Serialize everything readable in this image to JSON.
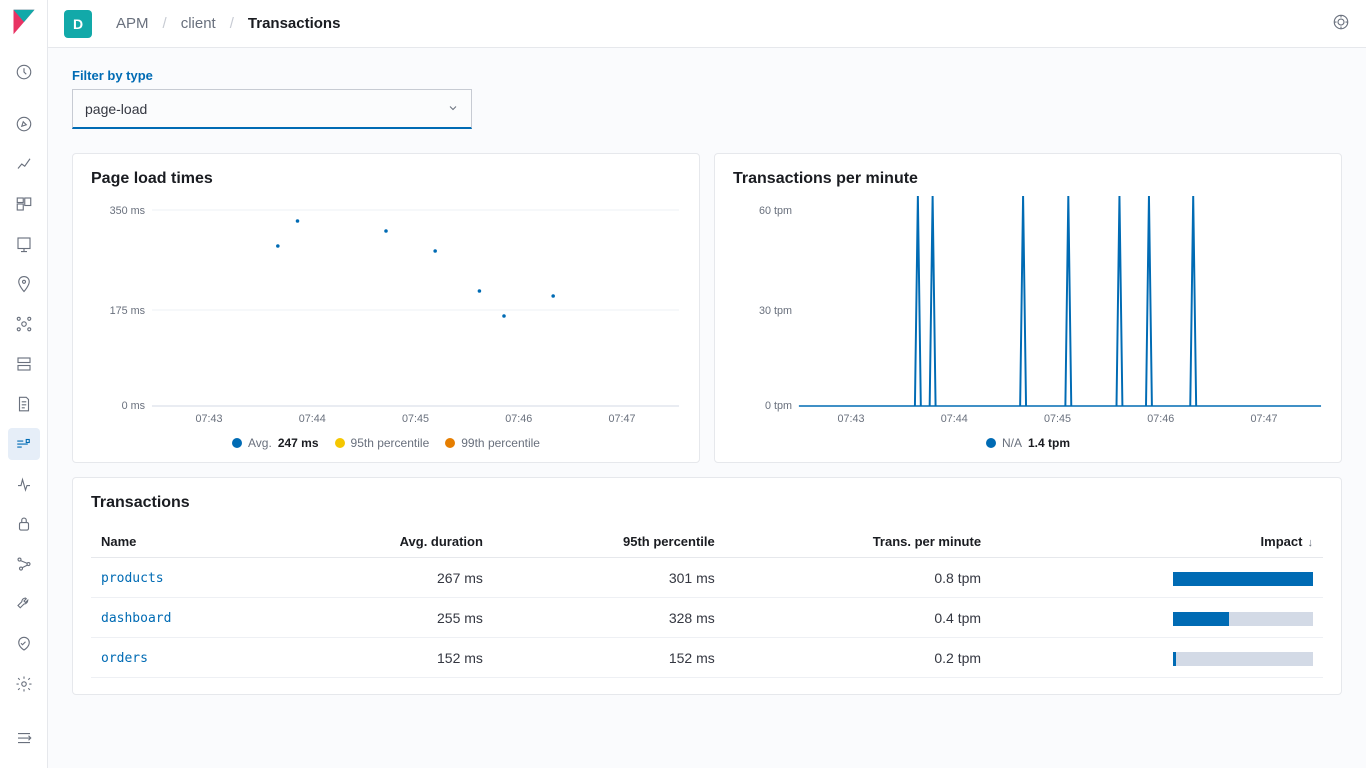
{
  "header": {
    "space_letter": "D",
    "breadcrumbs": [
      "APM",
      "client",
      "Transactions"
    ]
  },
  "filter": {
    "label": "Filter by type",
    "value": "page-load"
  },
  "chart1": {
    "title": "Page load times",
    "y_ticks": [
      "350 ms",
      "175 ms",
      "0 ms"
    ],
    "x_ticks": [
      "07:43",
      "07:44",
      "07:45",
      "07:46",
      "07:47"
    ],
    "legend": [
      {
        "color": "#006bb4",
        "label": "Avg.",
        "value": "247 ms"
      },
      {
        "color": "#f5c700",
        "label": "95th percentile",
        "value": ""
      },
      {
        "color": "#e67e00",
        "label": "99th percentile",
        "value": ""
      }
    ]
  },
  "chart2": {
    "title": "Transactions per minute",
    "y_ticks": [
      "60 tpm",
      "30 tpm",
      "0 tpm"
    ],
    "x_ticks": [
      "07:43",
      "07:44",
      "07:45",
      "07:46",
      "07:47"
    ],
    "legend": [
      {
        "color": "#006bb4",
        "label": "N/A",
        "value": "1.4 tpm"
      }
    ]
  },
  "table": {
    "title": "Transactions",
    "columns": [
      "Name",
      "Avg. duration",
      "95th percentile",
      "Trans. per minute",
      "Impact"
    ],
    "rows": [
      {
        "name": "products",
        "avg": "267 ms",
        "p95": "301 ms",
        "tpm": "0.8 tpm",
        "impact": 100
      },
      {
        "name": "dashboard",
        "avg": "255 ms",
        "p95": "328 ms",
        "tpm": "0.4 tpm",
        "impact": 40
      },
      {
        "name": "orders",
        "avg": "152 ms",
        "p95": "152 ms",
        "tpm": "0.2 tpm",
        "impact": 2
      }
    ]
  },
  "chart_data": [
    {
      "type": "scatter",
      "title": "Page load times",
      "xlabel": "",
      "ylabel": "",
      "x_range": [
        "07:43",
        "07:47"
      ],
      "ylim": [
        0,
        350
      ],
      "y_unit": "ms",
      "series": [
        {
          "name": "Avg.",
          "color": "#006bb4",
          "points": [
            {
              "x": "07:43:40",
              "y": 260
            },
            {
              "x": "07:43:55",
              "y": 330
            },
            {
              "x": "07:44:45",
              "y": 320
            },
            {
              "x": "07:45:10",
              "y": 280
            },
            {
              "x": "07:45:40",
              "y": 210
            },
            {
              "x": "07:45:50",
              "y": 175
            },
            {
              "x": "07:46:20",
              "y": 230
            }
          ]
        },
        {
          "name": "95th percentile",
          "color": "#f5c700",
          "points": []
        },
        {
          "name": "99th percentile",
          "color": "#e67e00",
          "points": []
        }
      ]
    },
    {
      "type": "line",
      "title": "Transactions per minute",
      "xlabel": "",
      "ylabel": "",
      "x_range": [
        "07:43",
        "07:47"
      ],
      "ylim": [
        0,
        60
      ],
      "y_unit": "tpm",
      "series": [
        {
          "name": "N/A",
          "color": "#006bb4",
          "spikes_at": [
            "07:43:40",
            "07:43:52",
            "07:44:40",
            "07:45:05",
            "07:45:35",
            "07:45:50",
            "07:46:15"
          ],
          "spike_value": 60,
          "baseline": 0
        }
      ]
    }
  ]
}
